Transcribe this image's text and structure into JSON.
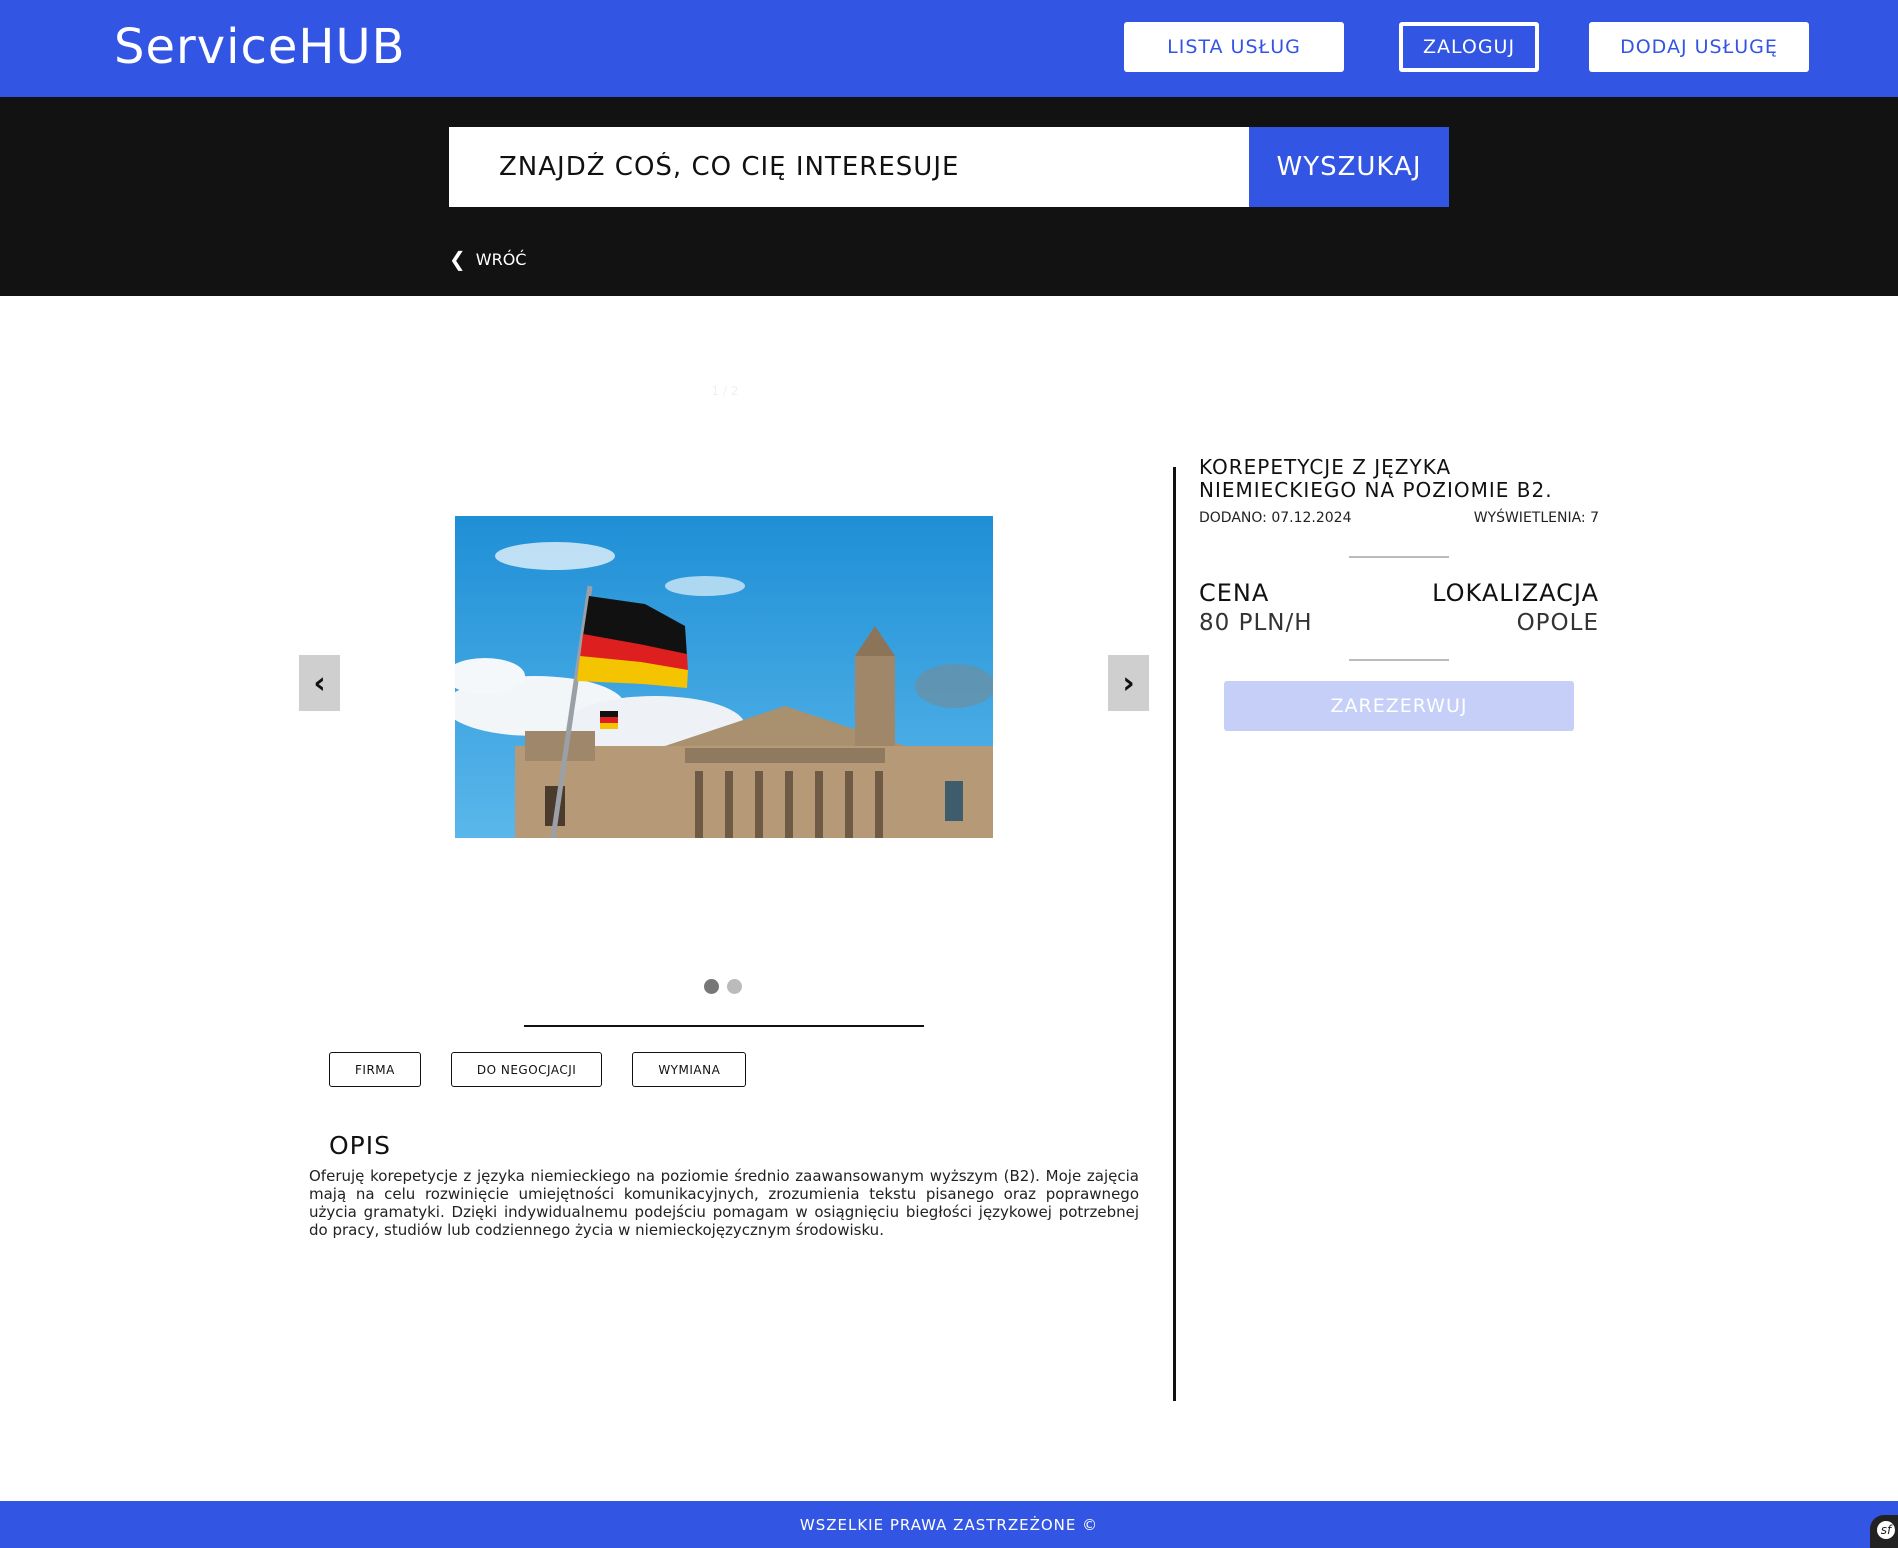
{
  "header": {
    "logo": "ServiceHUB",
    "nav": {
      "list": "LISTA USŁUG",
      "login": "ZALOGUJ",
      "add": "DODAJ USŁUGĘ"
    }
  },
  "search": {
    "placeholder": "ZNAJDŹ COŚ, CO CIĘ INTERESUJE",
    "button": "WYSZUKAJ",
    "back": "WRÓĆ"
  },
  "gallery": {
    "counter": "1 / 2",
    "prev": "‹",
    "next": "›",
    "dots_total": 2,
    "active_index": 0
  },
  "tags": [
    "FIRMA",
    "DO NEGOCJACJI",
    "WYMIANA"
  ],
  "description": {
    "title": "OPIS",
    "text": "Oferuję korepetycje z języka niemieckiego na poziomie średnio zaawansowanym wyższym (B2). Moje zajęcia mają na celu rozwinięcie umiejętności komunikacyjnych, zrozumienia tekstu pisanego oraz poprawnego użycia gramatyki. Dzięki indywidualnemu podejściu pomagam w osiągnięciu biegłości językowej potrzebnej do pracy, studiów lub codziennego życia w niemieckojęzycznym środowisku."
  },
  "listing": {
    "title": "KOREPETYCJE Z JĘZYKA NIEMIECKIEGO NA POZIOMIE B2.",
    "added": "DODANO: 07.12.2024",
    "views": "WYŚWIETLENIA: 7",
    "price_label": "CENA",
    "price_value": "80 PLN/H",
    "location_label": "LOKALIZACJA",
    "location_value": "OPOLE",
    "reserve": "ZAREZERWUJ"
  },
  "footer": {
    "text": "WSZELKIE PRAWA ZASTRZEŻONE ©",
    "badge": "sf"
  },
  "colors": {
    "brand": "#3355e3",
    "dark": "#121212",
    "reserve_disabled": "#c5cff7"
  }
}
